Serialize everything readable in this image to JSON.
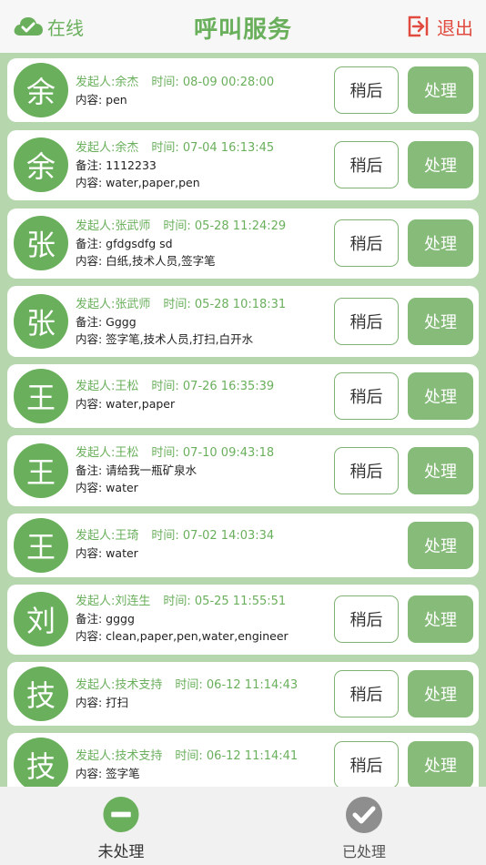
{
  "header": {
    "status_text": "在线",
    "title": "呼叫服务",
    "logout_text": "退出",
    "accent_color": "#6aaf5c",
    "logout_color": "#e04a3f"
  },
  "labels": {
    "later": "稍后",
    "handle": "处理"
  },
  "requests": [
    {
      "avatar": "余",
      "sender": "发起人:余杰",
      "time": "时间: 08-09 00:28:00",
      "note": "",
      "content": "内容: pen",
      "later": true
    },
    {
      "avatar": "余",
      "sender": "发起人:余杰",
      "time": "时间: 07-04 16:13:45",
      "note": "备注: 1112233",
      "content": "内容: water,paper,pen",
      "later": true
    },
    {
      "avatar": "张",
      "sender": "发起人:张武师",
      "time": "时间: 05-28 11:24:29",
      "note": "备注: gfdgsdfg sd",
      "content": "内容: 白纸,技术人员,签字笔",
      "later": true
    },
    {
      "avatar": "张",
      "sender": "发起人:张武师",
      "time": "时间: 05-28 10:18:31",
      "note": "备注: Gggg",
      "content": "内容: 签字笔,技术人员,打扫,白开水",
      "later": true
    },
    {
      "avatar": "王",
      "sender": "发起人:王松",
      "time": "时间: 07-26 16:35:39",
      "note": "",
      "content": "内容: water,paper",
      "later": true
    },
    {
      "avatar": "王",
      "sender": "发起人:王松",
      "time": "时间: 07-10 09:43:18",
      "note": "备注: 请给我一瓶矿泉水",
      "content": "内容: water",
      "later": true
    },
    {
      "avatar": "王",
      "sender": "发起人:王琦",
      "time": "时间: 07-02 14:03:34",
      "note": "",
      "content": "内容: water",
      "later": false
    },
    {
      "avatar": "刘",
      "sender": "发起人:刘连生",
      "time": "时间: 05-25 11:55:51",
      "note": "备注: gggg",
      "content": "内容: clean,paper,pen,water,engineer",
      "later": true
    },
    {
      "avatar": "技",
      "sender": "发起人:技术支持",
      "time": "时间: 06-12 11:14:43",
      "note": "",
      "content": "内容: 打扫",
      "later": true
    },
    {
      "avatar": "技",
      "sender": "发起人:技术支持",
      "time": "时间: 06-12 11:14:41",
      "note": "",
      "content": "内容: 签字笔",
      "later": true
    }
  ],
  "tabs": {
    "pending": "未处理",
    "done": "已处理"
  }
}
